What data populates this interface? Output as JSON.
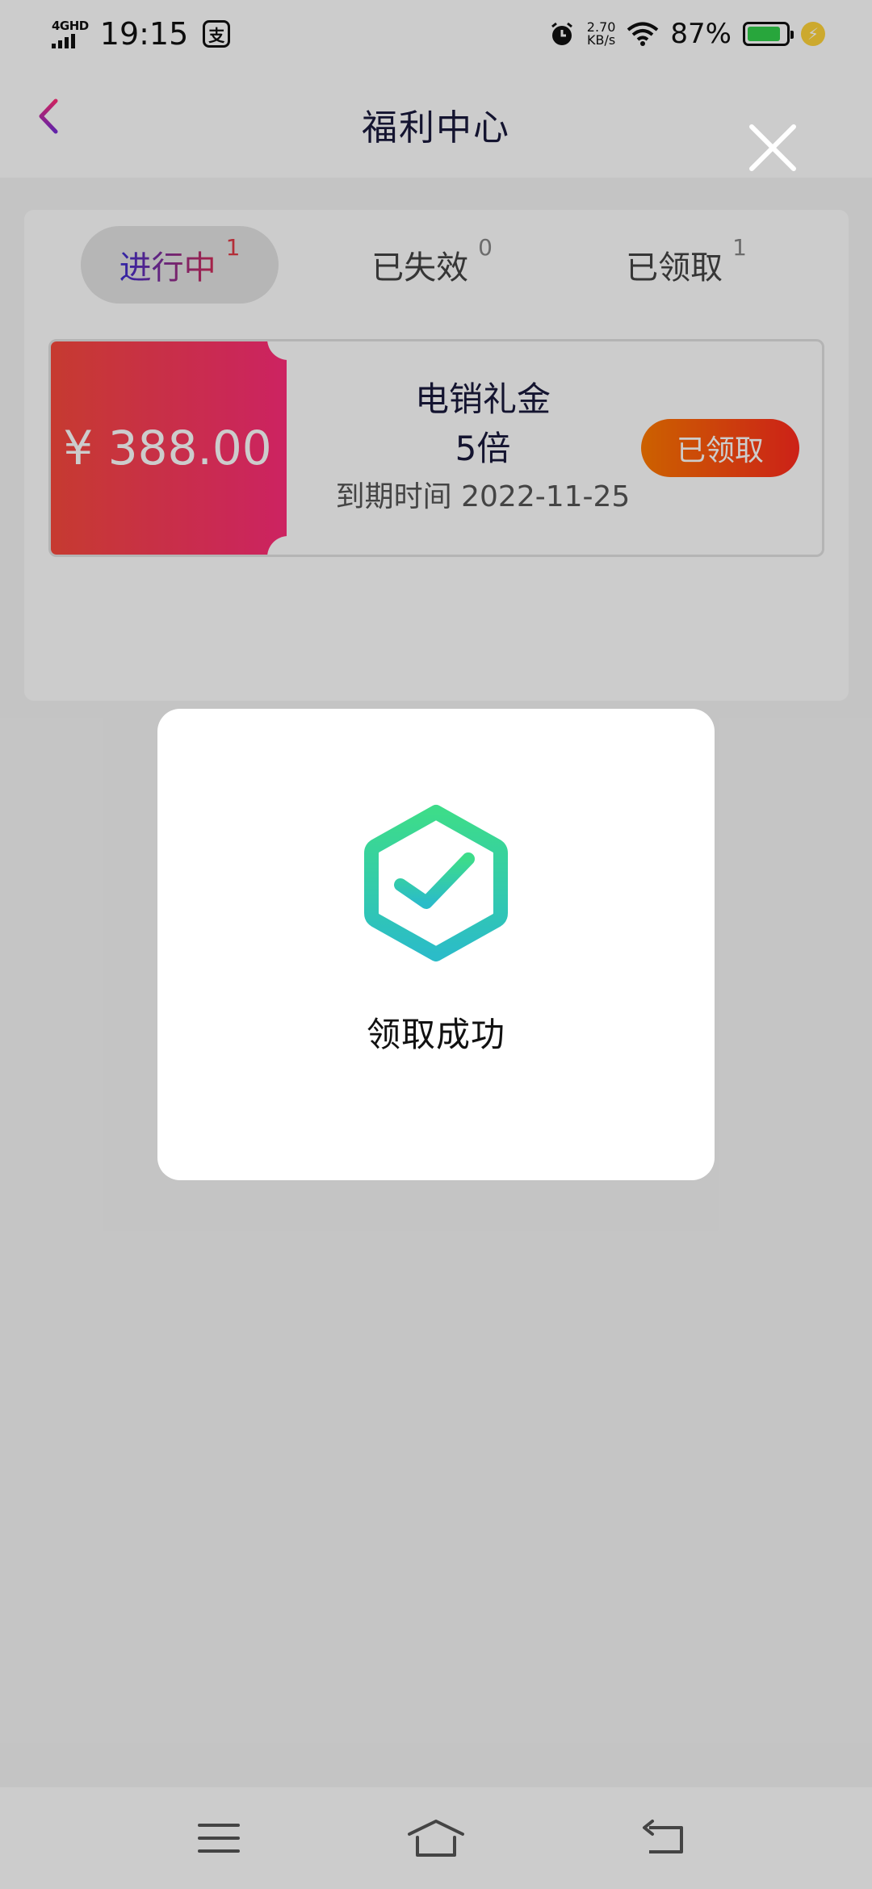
{
  "status_bar": {
    "network": "4GHD",
    "time": "19:15",
    "app_badge": "支",
    "speed_value": "2.70",
    "speed_unit": "KB/s",
    "battery_percent": "87%",
    "battery_level": 0.87,
    "battery_color": "#33d04b"
  },
  "header": {
    "title": "福利中心",
    "back_icon": "chevron-left-icon"
  },
  "tabs": [
    {
      "label": "进行中",
      "count": "1",
      "active": true
    },
    {
      "label": "已失效",
      "count": "0",
      "active": false
    },
    {
      "label": "已领取",
      "count": "1",
      "active": false
    }
  ],
  "coupon": {
    "amount": "¥ 388.00",
    "name": "电销礼金",
    "multiplier": "5倍",
    "expiry": "到期时间 2022-11-25",
    "button_label": "已领取"
  },
  "dialog": {
    "message": "领取成功",
    "icon": "check-hexagon-icon"
  },
  "nav_bar": {
    "items": [
      "menu-icon",
      "home-icon",
      "back-icon"
    ]
  },
  "colors": {
    "accent_red": "#ff2c7a",
    "accent_orange": "#ff7a00",
    "success_green": "#3ddc8a",
    "success_teal": "#2bbcc8"
  }
}
